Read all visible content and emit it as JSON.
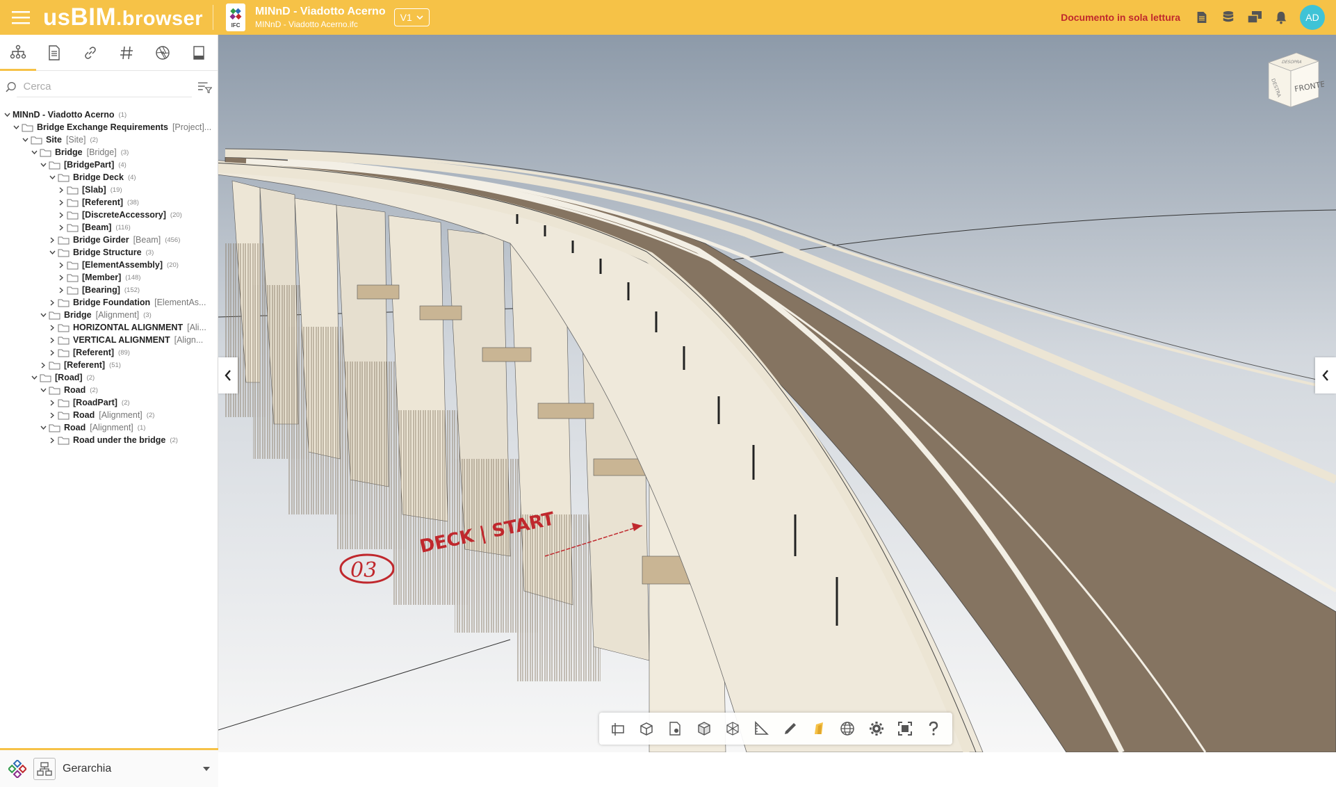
{
  "header": {
    "logo_us": "us",
    "logo_bim": "BIM",
    "logo_browser": ".browser",
    "doc_title": "MINnD - Viadotto Acerno",
    "doc_subtitle": "MINnD - Viadotto Acerno.ifc",
    "ifc_badge": "IFC",
    "version": "V1",
    "readonly_label": "Documento in sola lettura",
    "avatar_initials": "AD"
  },
  "sidebar": {
    "search_placeholder": "Cerca",
    "tree": [
      {
        "name": "MINnD - Viadotto Acerno",
        "type": "",
        "count": "(1)",
        "level": 0,
        "expanded": true,
        "folder": false
      },
      {
        "name": "Bridge Exchange Requirements",
        "type": "[Project]...",
        "count": "",
        "level": 1,
        "expanded": true,
        "folder": true
      },
      {
        "name": "Site",
        "type": "[Site]",
        "count": "(2)",
        "level": 2,
        "expanded": true,
        "folder": true
      },
      {
        "name": "Bridge",
        "type": "[Bridge]",
        "count": "(3)",
        "level": 3,
        "expanded": true,
        "folder": true
      },
      {
        "name": "[BridgePart]",
        "type": "",
        "count": "(4)",
        "level": 4,
        "expanded": true,
        "folder": true
      },
      {
        "name": "Bridge Deck",
        "type": "",
        "count": "(4)",
        "level": 5,
        "expanded": true,
        "folder": true
      },
      {
        "name": "[Slab]",
        "type": "",
        "count": "(19)",
        "level": 6,
        "expanded": false,
        "folder": true
      },
      {
        "name": "[Referent]",
        "type": "",
        "count": "(38)",
        "level": 6,
        "expanded": false,
        "folder": true
      },
      {
        "name": "[DiscreteAccessory]",
        "type": "",
        "count": "(20)",
        "level": 6,
        "expanded": false,
        "folder": true
      },
      {
        "name": "[Beam]",
        "type": "",
        "count": "(116)",
        "level": 6,
        "expanded": false,
        "folder": true
      },
      {
        "name": "Bridge Girder",
        "type": "[Beam]",
        "count": "(456)",
        "level": 5,
        "expanded": false,
        "folder": true
      },
      {
        "name": "Bridge Structure",
        "type": "",
        "count": "(3)",
        "level": 5,
        "expanded": true,
        "folder": true
      },
      {
        "name": "[ElementAssembly]",
        "type": "",
        "count": "(20)",
        "level": 6,
        "expanded": false,
        "folder": true
      },
      {
        "name": "[Member]",
        "type": "",
        "count": "(148)",
        "level": 6,
        "expanded": false,
        "folder": true
      },
      {
        "name": "[Bearing]",
        "type": "",
        "count": "(152)",
        "level": 6,
        "expanded": false,
        "folder": true
      },
      {
        "name": "Bridge Foundation",
        "type": "[ElementAs...",
        "count": "",
        "level": 5,
        "expanded": false,
        "folder": true
      },
      {
        "name": "Bridge",
        "type": "[Alignment]",
        "count": "(3)",
        "level": 4,
        "expanded": true,
        "folder": true
      },
      {
        "name": "HORIZONTAL ALIGNMENT",
        "type": "[Ali...",
        "count": "",
        "level": 5,
        "expanded": false,
        "folder": true
      },
      {
        "name": "VERTICAL ALIGNMENT",
        "type": "[Align...",
        "count": "",
        "level": 5,
        "expanded": false,
        "folder": true
      },
      {
        "name": "[Referent]",
        "type": "",
        "count": "(89)",
        "level": 5,
        "expanded": false,
        "folder": true
      },
      {
        "name": "[Referent]",
        "type": "",
        "count": "(51)",
        "level": 4,
        "expanded": false,
        "folder": true
      },
      {
        "name": "[Road]",
        "type": "",
        "count": "(2)",
        "level": 3,
        "expanded": true,
        "folder": true
      },
      {
        "name": "Road",
        "type": "",
        "count": "(2)",
        "level": 4,
        "expanded": true,
        "folder": true
      },
      {
        "name": "[RoadPart]",
        "type": "",
        "count": "(2)",
        "level": 5,
        "expanded": false,
        "folder": true
      },
      {
        "name": "Road",
        "type": "[Alignment]",
        "count": "(2)",
        "level": 5,
        "expanded": false,
        "folder": true
      },
      {
        "name": "Road",
        "type": "[Alignment]",
        "count": "(1)",
        "level": 4,
        "expanded": true,
        "folder": true
      },
      {
        "name": "Road under the bridge",
        "type": "",
        "count": "(2)",
        "level": 5,
        "expanded": false,
        "folder": true
      }
    ],
    "bottom_view_label": "Gerarchia"
  },
  "viewport": {
    "annotation_number": "03",
    "annotation_text": "DECK | START",
    "navcube_top": "DESOPRA",
    "navcube_front": "FRONTE",
    "navcube_side": "DESTRA"
  },
  "toolbar": {
    "tools": [
      "section-icon",
      "box-icon",
      "location-icon",
      "cube-icon",
      "wireframe-icon",
      "measure-icon",
      "pen-icon",
      "highlight-icon",
      "globe-icon",
      "settings-icon",
      "fullscreen-icon",
      "help-icon"
    ]
  },
  "colors": {
    "accent": "#f6c247",
    "readonly": "#c0282d",
    "avatar": "#3fc3d6",
    "sky_top": "#8d9aa9",
    "sky_bottom": "#f7f7f7",
    "deck": "#857461",
    "concrete": "#e9e2d2"
  }
}
